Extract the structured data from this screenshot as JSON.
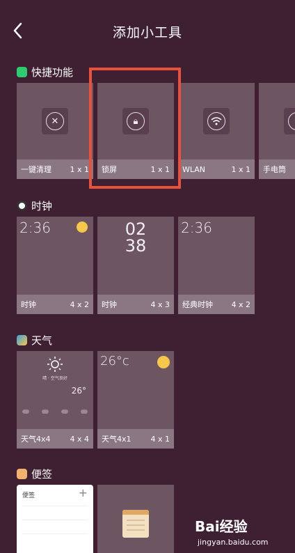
{
  "header": {
    "title": "添加小工具",
    "back_icon": "back-arrow-icon"
  },
  "sections": {
    "quick": {
      "label": "快捷功能",
      "color": "#2ecc71"
    },
    "clock": {
      "label": "时钟"
    },
    "weather": {
      "label": "天气"
    },
    "notes": {
      "label": "便签"
    }
  },
  "quick_items": [
    {
      "label": "一键清理",
      "size": "1 x 1",
      "icon": "close-icon"
    },
    {
      "label": "锁屏",
      "size": "1 x 1",
      "icon": "lock-icon"
    },
    {
      "label": "WLAN",
      "size": "1 x 1",
      "icon": "wifi-icon"
    },
    {
      "label": "手电筒",
      "size": "",
      "icon": "flashlight-icon"
    }
  ],
  "clock_items": [
    {
      "label": "时钟",
      "size": "4 x 2",
      "time": "2:36"
    },
    {
      "label": "时钟",
      "size": "4 x 3",
      "hour": "02",
      "minute": "38"
    },
    {
      "label": "经典时钟",
      "size": "4 x 2",
      "time": "2:36"
    }
  ],
  "weather_items": [
    {
      "label": "天气4x4",
      "size": "4 x 4",
      "desc": "晴 · 空气良好",
      "temp": "26°"
    },
    {
      "label": "天气4x1",
      "size": "4 x 1",
      "temp": "26°c"
    }
  ],
  "notes_items": [
    {
      "label": "便签"
    },
    {
      "label": ""
    }
  ],
  "watermark": {
    "line1": "Bai经验",
    "line2": "jingyan.baidu.com"
  }
}
